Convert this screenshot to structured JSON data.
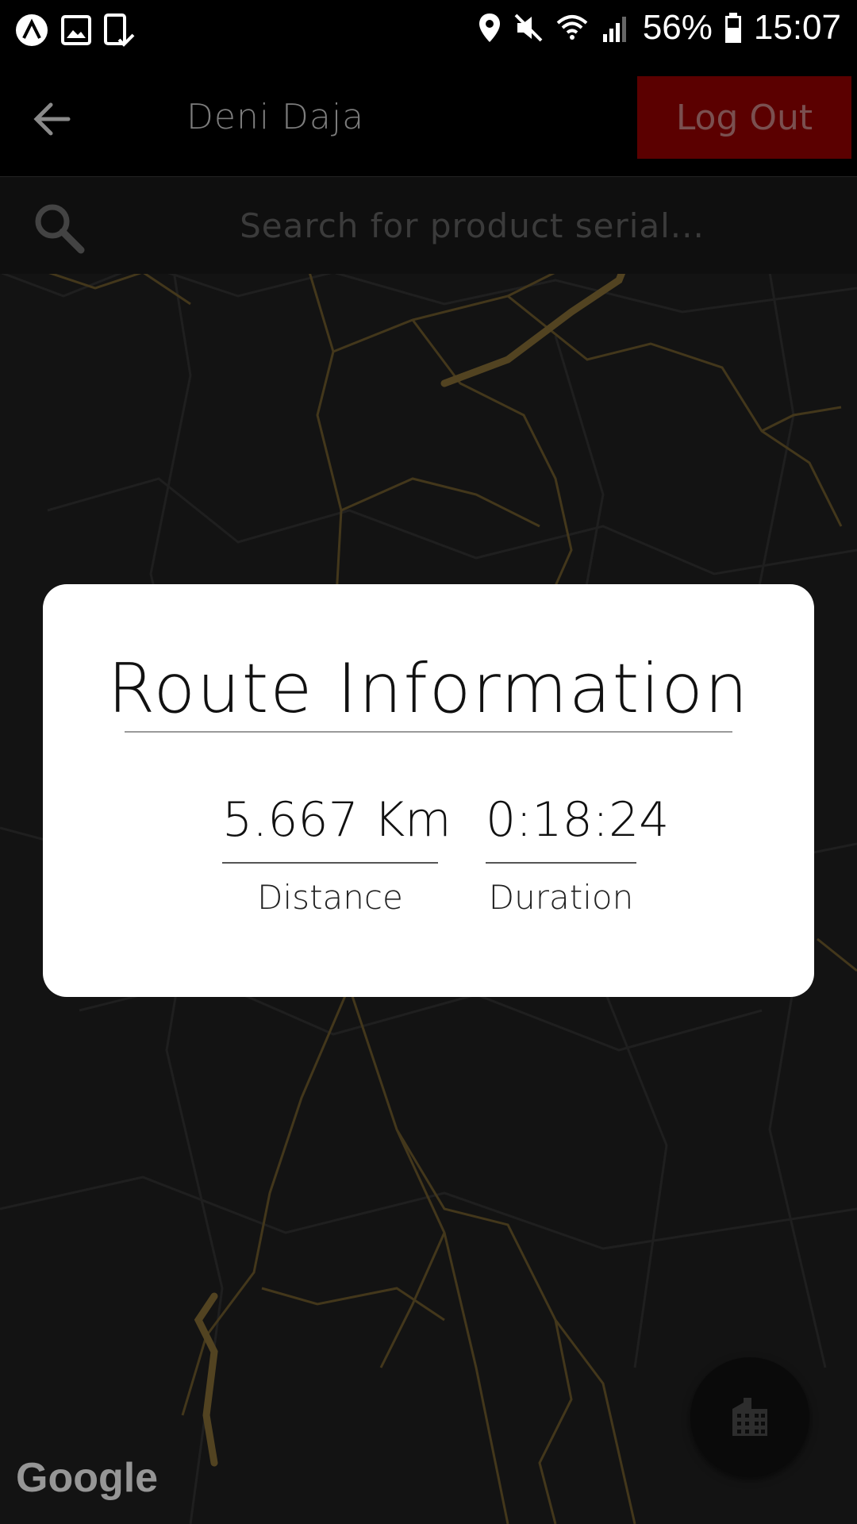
{
  "status_bar": {
    "battery": "56%",
    "time": "15:07",
    "icons": [
      "app-icon",
      "gallery-icon",
      "tablet-check-icon",
      "location-icon",
      "mute-icon",
      "wifi-icon",
      "signal-icon",
      "battery-icon"
    ]
  },
  "app_bar": {
    "user_name": "Deni Daja",
    "logout_label": "Log Out"
  },
  "search": {
    "placeholder": "Search for product serial..."
  },
  "map": {
    "attribution": "Google",
    "road_color": "#6e5a2c"
  },
  "dialog": {
    "title": "Route Information",
    "distance_value": "5.667 Km",
    "distance_label": "Distance",
    "duration_value": "0:18:24",
    "duration_label": "Duration"
  },
  "fab": {
    "icon": "building-icon"
  },
  "colors": {
    "logout_bg": "#5b0000",
    "map_bg": "#1a1a1a"
  }
}
